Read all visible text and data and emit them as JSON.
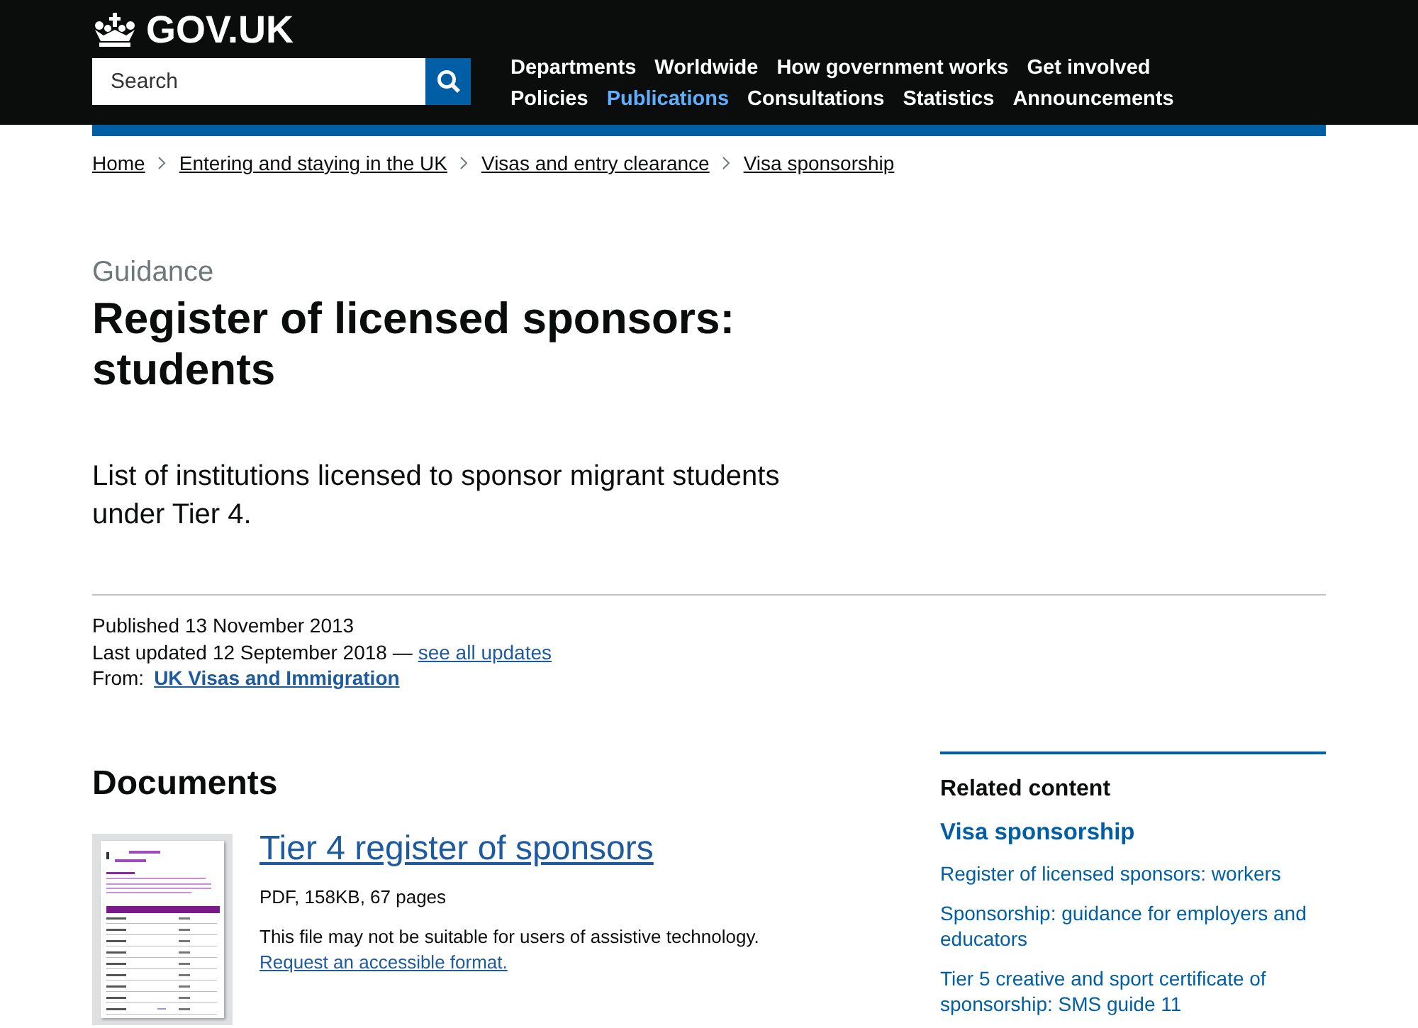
{
  "header": {
    "logo": "GOV.UK",
    "search": {
      "placeholder": "Search"
    },
    "nav": [
      {
        "label": "Departments",
        "selected": false
      },
      {
        "label": "Worldwide",
        "selected": false
      },
      {
        "label": "How government works",
        "selected": false
      },
      {
        "label": "Get involved",
        "selected": false
      },
      {
        "label": "Policies",
        "selected": false
      },
      {
        "label": "Publications",
        "selected": true
      },
      {
        "label": "Consultations",
        "selected": false
      },
      {
        "label": "Statistics",
        "selected": false
      },
      {
        "label": "Announcements",
        "selected": false
      }
    ]
  },
  "breadcrumbs": [
    "Home",
    "Entering and staying in the UK",
    "Visas and entry clearance",
    "Visa sponsorship"
  ],
  "page": {
    "type": "Guidance",
    "title": "Register of licensed sponsors: students",
    "description": "List of institutions licensed to sponsor migrant students under Tier 4."
  },
  "metadata": {
    "published": {
      "label": "Published",
      "value": "13 November 2013"
    },
    "updated": {
      "label": "Last updated",
      "value": "12 September 2018 —",
      "link": "see all updates"
    },
    "from": {
      "label": "From:",
      "link": "UK Visas and Immigration"
    }
  },
  "documents": {
    "heading": "Documents",
    "items": [
      {
        "title": "Tier 4 register of sponsors",
        "meta": "PDF, 158KB, 67 pages",
        "notice": "This file may not be suitable for users of assistive technology.",
        "notice_link": "Request an accessible format."
      }
    ]
  },
  "related": {
    "heading": "Related content",
    "section": "Visa sponsorship",
    "links": [
      "Register of licensed sponsors: workers",
      "Sponsorship: guidance for employers and educators",
      "Tier 5 creative and sport certificate of sponsorship: SMS guide 11"
    ]
  }
}
